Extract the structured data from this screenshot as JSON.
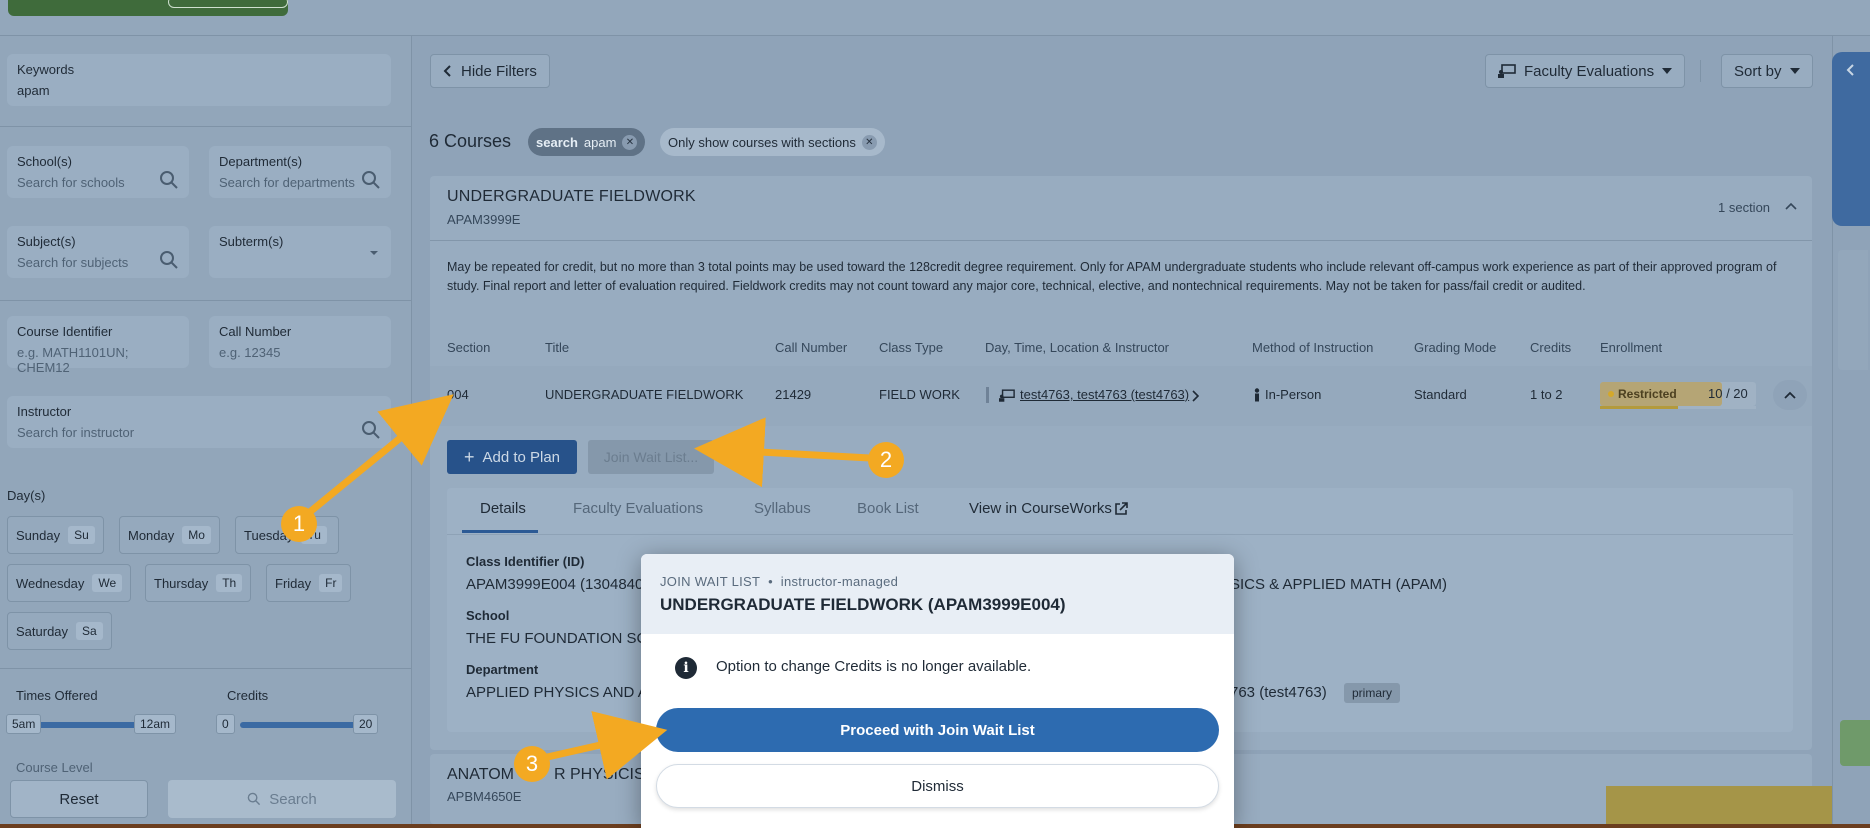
{
  "filters": {
    "keywords_label": "Keywords",
    "keywords_value": "apam",
    "schools_label": "School(s)",
    "schools_placeholder": "Search for schools",
    "departments_label": "Department(s)",
    "departments_placeholder": "Search for departments",
    "subjects_label": "Subject(s)",
    "subjects_placeholder": "Search for subjects",
    "subterm_label": "Subterm(s)",
    "course_id_label": "Course Identifier",
    "course_id_placeholder": "e.g. MATH1101UN; CHEM12",
    "call_number_label": "Call Number",
    "call_number_placeholder": "e.g. 12345",
    "instructor_label": "Instructor",
    "instructor_placeholder": "Search for instructor",
    "days_label": "Day(s)",
    "days": [
      {
        "name": "Sunday",
        "abbr": "Su"
      },
      {
        "name": "Monday",
        "abbr": "Mo"
      },
      {
        "name": "Tuesday",
        "abbr": "Tu"
      },
      {
        "name": "Wednesday",
        "abbr": "We"
      },
      {
        "name": "Thursday",
        "abbr": "Th"
      },
      {
        "name": "Friday",
        "abbr": "Fr"
      },
      {
        "name": "Saturday",
        "abbr": "Sa"
      }
    ],
    "times_label": "Times Offered",
    "times_min": "5am",
    "times_max": "12am",
    "credits_label": "Credits",
    "credits_min": "0",
    "credits_max": "20",
    "course_level_label": "Course Level",
    "reset_label": "Reset",
    "search_label": "Search"
  },
  "toolbar": {
    "hide_filters": "Hide Filters",
    "faculty_evaluations": "Faculty Evaluations",
    "sort_by": "Sort by"
  },
  "results": {
    "count": "6 Courses",
    "chip_search_key": "search",
    "chip_search_value": "apam",
    "chip_sections": "Only show courses with sections"
  },
  "course": {
    "title": "UNDERGRADUATE FIELDWORK",
    "code": "APAM3999E",
    "section_count": "1 section",
    "description": "May be repeated for credit, but no more than 3 total points may be used toward the 128credit degree requirement. Only for APAM undergraduate students who include relevant off-campus work experience as part of their approved program of study. Final report and letter of evaluation required. Fieldwork credits may not count toward any major core, technical, elective, and nontechnical requirements. May not be taken for pass/fail credit or audited.",
    "columns": [
      "Section",
      "Title",
      "Call Number",
      "Class Type",
      "Day, Time, Location & Instructor",
      "Method of Instruction",
      "Grading Mode",
      "Credits",
      "Enrollment"
    ],
    "row": {
      "section": "004",
      "title": "UNDERGRADUATE FIELDWORK",
      "call_number": "21429",
      "class_type": "FIELD WORK",
      "instructor": "test4763, test4763 (test4763)",
      "method": "In-Person",
      "grading": "Standard",
      "credits": "1 to 2",
      "enrollment_status": "Restricted",
      "enrollment_count": "10 / 20",
      "enrollment_fraction": 0.5
    },
    "add_to_plan": "Add to Plan",
    "join_wait_list": "Join Wait List...",
    "tabs": [
      "Details",
      "Faculty Evaluations",
      "Syllabus",
      "Book List",
      "View in CourseWorks"
    ],
    "details": {
      "class_id_label": "Class Identifier (ID)",
      "class_id_value": "APAM3999E004 (1304840",
      "subject_value": "SICS & APPLIED MATH (APAM)",
      "school_label": "School",
      "school_value": "THE FU FOUNDATION SCH",
      "department_label": "Department",
      "department_value": "APPLIED PHYSICS AND AP",
      "instructor_value": "763 (test4763)",
      "instructor_badge": "primary"
    }
  },
  "next_course": {
    "title": "ANATOMY FOR PHYSICISTS",
    "title_visible": "ANATOM",
    "title_visible_2": "R PHYSICIST",
    "code": "APBM4650E"
  },
  "modal": {
    "kicker": "JOIN WAIT LIST",
    "kicker_sep": "•",
    "kicker_mode": "instructor-managed",
    "title": "UNDERGRADUATE FIELDWORK (APAM3999E004)",
    "info": "Option to change Credits is no longer available.",
    "proceed": "Proceed with Join Wait List",
    "dismiss": "Dismiss"
  },
  "annotations": [
    "1",
    "2",
    "3"
  ],
  "colors": {
    "primary": "#2d6bb0",
    "annotation": "#f3a922",
    "restricted": "#d4a82a"
  }
}
